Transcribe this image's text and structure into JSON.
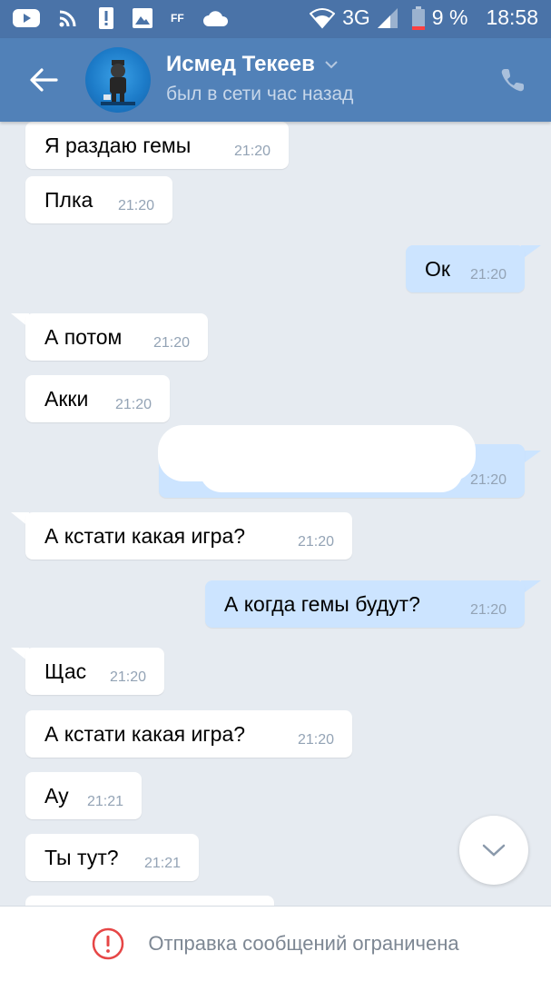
{
  "status_bar": {
    "network": "3G",
    "battery": "9 %",
    "time": "18:58",
    "icons": [
      "youtube-icon",
      "cast-icon",
      "alert-icon",
      "gallery-icon",
      "ff-icon",
      "cloud-icon",
      "wifi-icon",
      "signal-icon",
      "battery-icon"
    ],
    "ff_label": "FF"
  },
  "header": {
    "contact_name": "Исмед Текеев",
    "status": "был в сети час назад",
    "accent": "#5181b8"
  },
  "messages": [
    {
      "side": "in",
      "text": "Я раздаю гемы",
      "time": "21:20"
    },
    {
      "side": "in",
      "text": "Плка",
      "time": "21:20"
    },
    {
      "side": "out",
      "text": "Ок",
      "time": "21:20"
    },
    {
      "side": "in",
      "text": "А потом",
      "time": "21:20"
    },
    {
      "side": "in",
      "text": "Акки",
      "time": "21:20"
    },
    {
      "side": "out",
      "text": "",
      "time": "21:20",
      "redacted": true
    },
    {
      "side": "in",
      "text": "А кстати какая игра?",
      "time": "21:20"
    },
    {
      "side": "out",
      "text": "А когда гемы будут?",
      "time": "21:20"
    },
    {
      "side": "in",
      "text": "Щас",
      "time": "21:20"
    },
    {
      "side": "in",
      "text": "А кстати какая игра?",
      "time": "21:20"
    },
    {
      "side": "in",
      "text": "Ау",
      "time": "21:21"
    },
    {
      "side": "in",
      "text": "Ты тут?",
      "time": "21:21"
    }
  ],
  "bottom": {
    "restricted_text": "Отправка сообщений ограничена"
  }
}
